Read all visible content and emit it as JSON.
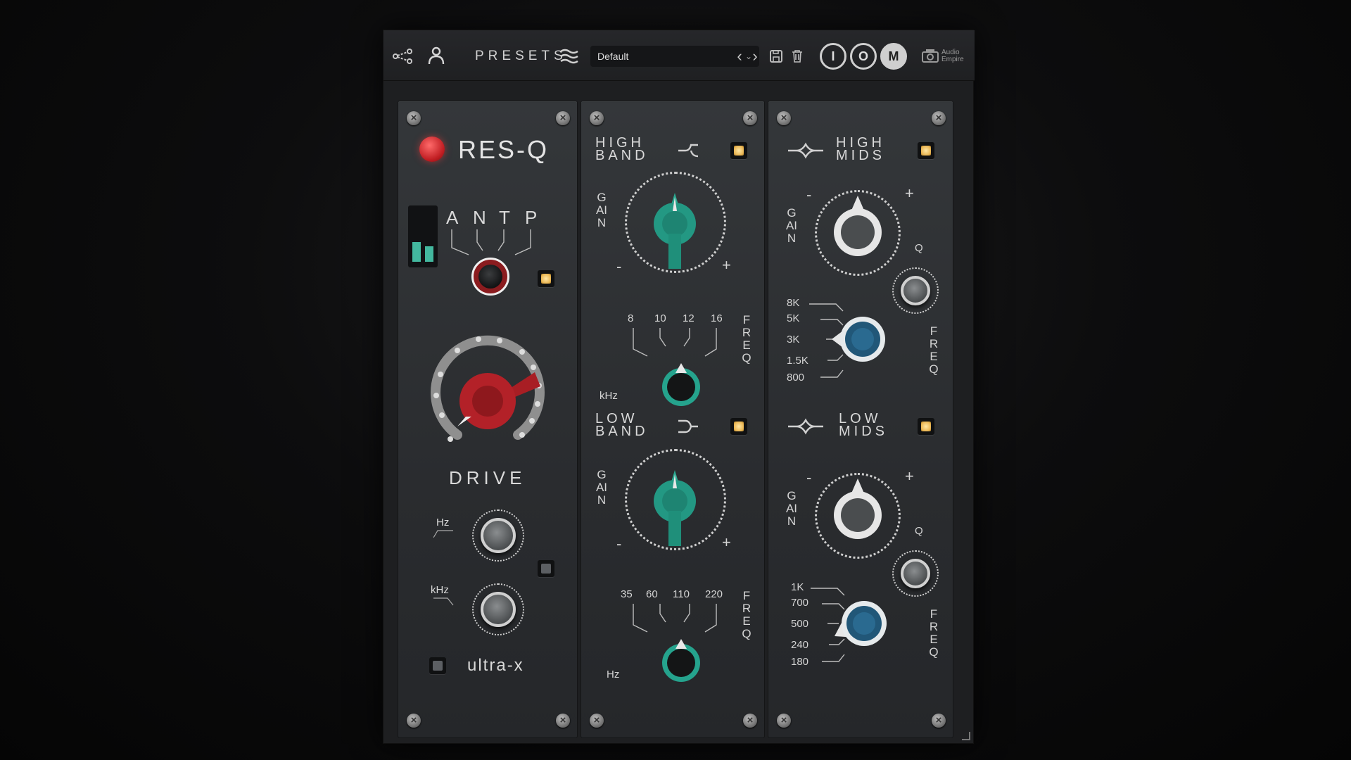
{
  "topbar": {
    "presets_label": "PRESETS",
    "preset_name": "Default",
    "buttons": {
      "i": "I",
      "o": "O",
      "m": "M"
    },
    "logo_text": "Audio Empire"
  },
  "colors": {
    "accent_teal": "#2aa08b",
    "accent_red": "#c3242b",
    "lamp": "#f0c060",
    "blue_knob": "#2a6a90"
  },
  "res_q": {
    "title": "RES-Q",
    "modes": [
      "A",
      "N",
      "T",
      "P"
    ],
    "drive_label": "DRIVE",
    "hz_label": "Hz",
    "khz_label": "kHz",
    "ultra_label": "ultra-x"
  },
  "high_band": {
    "title_line1": "HIGH",
    "title_line2": "BAND",
    "gain_label": "GAIN",
    "minus": "-",
    "plus": "+",
    "freq_label": "FREQ",
    "unit": "kHz",
    "freqs": [
      "8",
      "10",
      "12",
      "16"
    ]
  },
  "low_band": {
    "title_line1": "LOW",
    "title_line2": "BAND",
    "gain_label": "GAIN",
    "minus": "-",
    "plus": "+",
    "freq_label": "FREQ",
    "unit": "Hz",
    "freqs": [
      "35",
      "60",
      "110",
      "220"
    ]
  },
  "high_mids": {
    "title_line1": "HIGH",
    "title_line2": "MIDS",
    "gain_label": "GAIN",
    "minus": "-",
    "plus": "+",
    "q_label": "Q",
    "freq_label": "FREQ",
    "freqs": [
      "8K",
      "5K",
      "3K",
      "1.5K",
      "800"
    ]
  },
  "low_mids": {
    "title_line1": "LOW",
    "title_line2": "MIDS",
    "gain_label": "GAIN",
    "minus": "-",
    "plus": "+",
    "q_label": "Q",
    "freq_label": "FREQ",
    "freqs": [
      "1K",
      "700",
      "500",
      "240",
      "180"
    ]
  }
}
